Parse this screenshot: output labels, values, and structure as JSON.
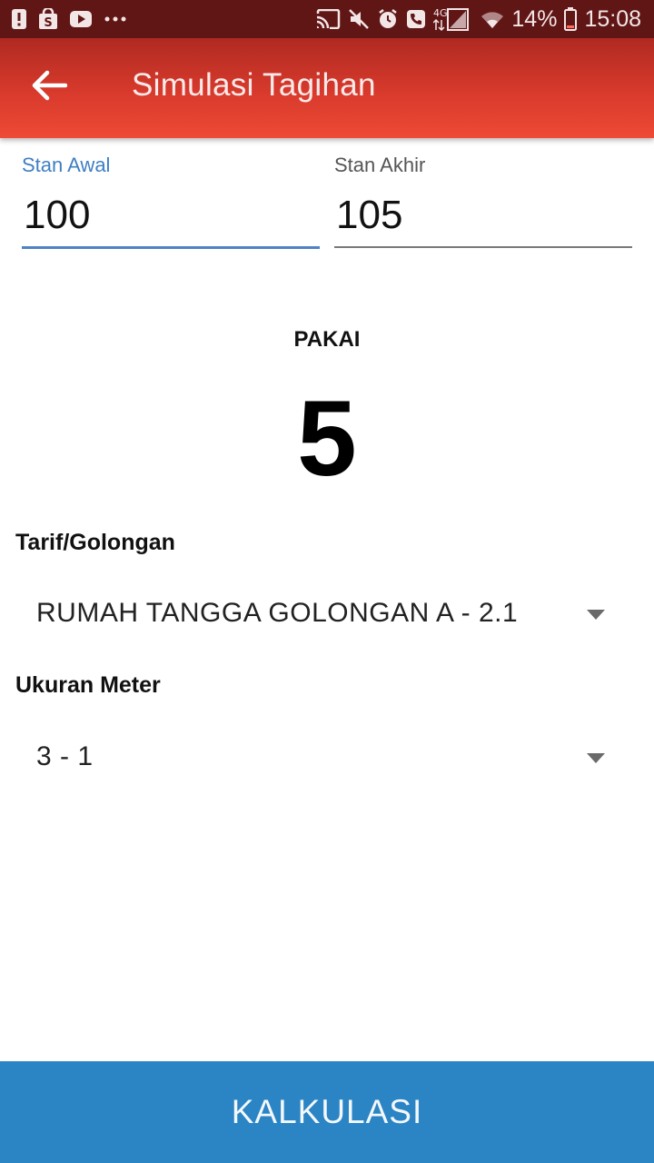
{
  "status_bar": {
    "icons_left": [
      "alert-icon",
      "shop-icon",
      "youtube-icon",
      "more-dots-icon"
    ],
    "icons_right": [
      "cast-icon",
      "mute-icon",
      "alarm-icon",
      "call-icon",
      "signal-4g-icon",
      "wifi-icon",
      "battery-icon"
    ],
    "network_label": "4G",
    "battery": "14%",
    "time": "15:08"
  },
  "appbar": {
    "title": "Simulasi Tagihan",
    "back_icon": "back-arrow-icon"
  },
  "stan_awal": {
    "label": "Stan Awal",
    "value": "100"
  },
  "stan_akhir": {
    "label": "Stan Akhir",
    "value": "105"
  },
  "pakai": {
    "label": "PAKAI",
    "value": "5"
  },
  "tarif": {
    "label": "Tarif/Golongan",
    "selected": "RUMAH TANGGA GOLONGAN A - 2.1"
  },
  "ukuran": {
    "label": "Ukuran Meter",
    "selected": "3 - 1"
  },
  "button": {
    "label": "KALKULASI"
  },
  "colors": {
    "status_bar": "#611616",
    "appbar": "#d83a2c",
    "accent": "#3f7fc4",
    "button": "#2b84c4"
  }
}
